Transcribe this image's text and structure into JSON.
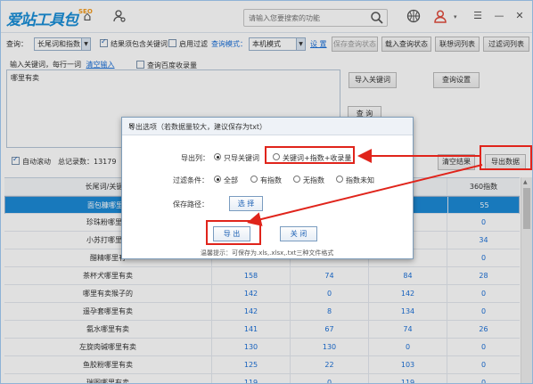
{
  "app": {
    "logo_main": "爱站工具包",
    "logo_seo": "SEO"
  },
  "titlebar": {
    "search_placeholder": "请输入您要搜索的功能"
  },
  "toolbar": {
    "query_label": "查询：",
    "query_mode_value": "长尾词和指数",
    "result_must_contain_label": "结果须包含关键词",
    "enable_filter_label": "启用过滤",
    "query_mode_label": "查询模式：",
    "local_mode_value": "本机模式",
    "settings_link": "设 置",
    "save_query_state": "保存查询状态",
    "load_query_state": "载入查询状态",
    "associate_list": "联想词列表",
    "filter_list": "过滤词列表"
  },
  "keywords": {
    "input_label": "输入关键词，每行一词",
    "clear_input_link": "清空输入",
    "baidu_index_label": "查询百度收录量",
    "textarea_value": "哪里有卖",
    "import_keywords": "导入关键词",
    "query_settings": "查询设置",
    "query_button": "查 询"
  },
  "status": {
    "auto_scroll_label": "自动滚动",
    "total_records": "总记录数：13179",
    "clear_results": "清空结果",
    "export_data": "导出数据"
  },
  "table": {
    "headers": [
      "长尾词/关键词",
      "",
      "",
      "",
      "360指数"
    ],
    "rows": [
      {
        "kw": "面包糠哪里有",
        "c1": "",
        "c2": "",
        "c3": "",
        "c4": "55",
        "selected": true
      },
      {
        "kw": "珍珠粉哪里有",
        "c1": "",
        "c2": "",
        "c3": "",
        "c4": "0"
      },
      {
        "kw": "小苏打哪里有",
        "c1": "",
        "c2": "",
        "c3": "",
        "c4": "34"
      },
      {
        "kw": "醋精哪里有",
        "c1": "",
        "c2": "",
        "c3": "",
        "c4": "0"
      },
      {
        "kw": "茶杯犬哪里有卖",
        "c1": "158",
        "c2": "74",
        "c3": "84",
        "c4": "28"
      },
      {
        "kw": "哪里有卖猴子的",
        "c1": "142",
        "c2": "0",
        "c3": "142",
        "c4": "0"
      },
      {
        "kw": "遥孕套哪里有卖",
        "c1": "142",
        "c2": "8",
        "c3": "134",
        "c4": "0"
      },
      {
        "kw": "氨水哪里有卖",
        "c1": "141",
        "c2": "67",
        "c3": "74",
        "c4": "26"
      },
      {
        "kw": "左旋肉碱哪里有卖",
        "c1": "130",
        "c2": "130",
        "c3": "0",
        "c4": "0"
      },
      {
        "kw": "鱼胶粉哪里有卖",
        "c1": "125",
        "c2": "22",
        "c3": "103",
        "c4": "0"
      },
      {
        "kw": "瑞图哪里有卖",
        "c1": "119",
        "c2": "0",
        "c3": "119",
        "c4": "0"
      }
    ]
  },
  "dialog": {
    "title": "导出选项（若数据量较大，建议保存为txt）",
    "export_columns_label": "导出列：",
    "only_keywords": "只导关键词",
    "keyword_index_count": "关键词+指数+收录量",
    "filter_label": "过滤条件：",
    "all": "全部",
    "has_index": "有指数",
    "no_index": "无指数",
    "unknown_index": "指数未知",
    "save_path_label": "保存路径：",
    "choose_button": "选 择",
    "export_button": "导 出",
    "close_button": "关 闭",
    "tip": "温馨提示：可保存为.xls,.xlsx,.txt三种文件格式"
  }
}
